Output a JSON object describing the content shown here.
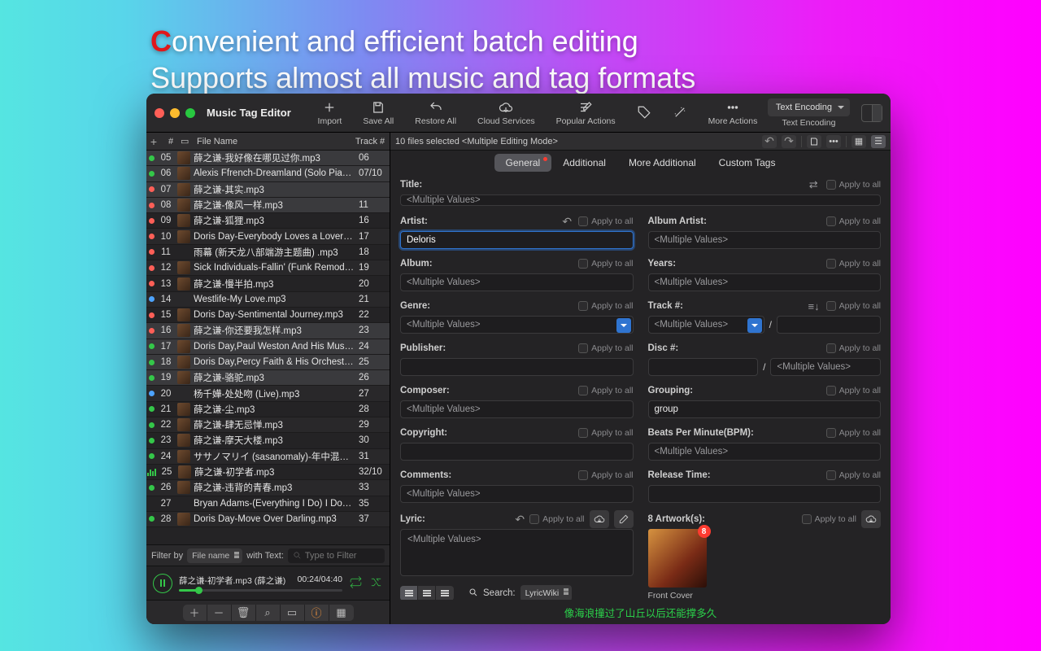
{
  "hero": {
    "cap": "C",
    "line1_rest": "onvenient and efficient batch editing",
    "line2": "Supports almost all music and tag formats"
  },
  "app_title": "Music Tag Editor",
  "toolbar": [
    {
      "icon": "plus",
      "label": "Import"
    },
    {
      "icon": "save",
      "label": "Save All"
    },
    {
      "icon": "undo",
      "label": "Restore All"
    },
    {
      "icon": "cloud",
      "label": "Cloud Services"
    },
    {
      "icon": "edit",
      "label": "Popular Actions"
    },
    {
      "icon": "tag",
      "label": ""
    },
    {
      "icon": "wand",
      "label": ""
    },
    {
      "icon": "dots",
      "label": "More Actions"
    }
  ],
  "text_encoding": {
    "label": "Text Encoding",
    "caption": "Text Encoding"
  },
  "columns": {
    "hash": "#",
    "file": "File Name",
    "track": "Track #"
  },
  "rows": [
    {
      "dot": "g",
      "n": "05",
      "name": "薛之谦-我好像在哪见过你.mp3",
      "trk": "06",
      "sel": true,
      "thumb": true
    },
    {
      "dot": "g",
      "n": "06",
      "name": "Alexis Ffrench-Dreamland (Solo Pia…",
      "trk": "07/10",
      "sel": true,
      "thumb": true
    },
    {
      "dot": "r",
      "n": "07",
      "name": "薛之谦-其实.mp3",
      "trk": "",
      "sel": true,
      "thumb": true
    },
    {
      "dot": "r",
      "n": "08",
      "name": "薛之谦-像风一样.mp3",
      "trk": "11",
      "sel": true,
      "thumb": true
    },
    {
      "dot": "r",
      "n": "09",
      "name": "薛之谦-狐狸.mp3",
      "trk": "16",
      "sel": false,
      "thumb": true
    },
    {
      "dot": "r",
      "n": "10",
      "name": "Doris Day-Everybody Loves a Lover…",
      "trk": "17",
      "sel": false,
      "thumb": true
    },
    {
      "dot": "r",
      "n": "11",
      "name": "雨幕 (新天龙八部端游主题曲) .mp3",
      "trk": "18",
      "sel": false,
      "thumb": false
    },
    {
      "dot": "r",
      "n": "12",
      "name": "Sick Individuals-Fallin' (Funk Remod…",
      "trk": "19",
      "sel": false,
      "thumb": true
    },
    {
      "dot": "r",
      "n": "13",
      "name": "薛之谦-慢半拍.mp3",
      "trk": "20",
      "sel": false,
      "thumb": true
    },
    {
      "dot": "b",
      "n": "14",
      "name": "Westlife-My Love.mp3",
      "trk": "21",
      "sel": false,
      "thumb": false
    },
    {
      "dot": "r",
      "n": "15",
      "name": "Doris Day-Sentimental Journey.mp3",
      "trk": "22",
      "sel": false,
      "thumb": true
    },
    {
      "dot": "r",
      "n": "16",
      "name": "薛之谦-你还要我怎样.mp3",
      "trk": "23",
      "sel": true,
      "thumb": true
    },
    {
      "dot": "g",
      "n": "17",
      "name": "Doris Day,Paul Weston And His Mus…",
      "trk": "24",
      "sel": true,
      "thumb": true
    },
    {
      "dot": "g",
      "n": "18",
      "name": "Doris Day,Percy Faith & His Orchest…",
      "trk": "25",
      "sel": true,
      "thumb": true
    },
    {
      "dot": "g",
      "n": "19",
      "name": "薛之谦-骆驼.mp3",
      "trk": "26",
      "sel": true,
      "thumb": true
    },
    {
      "dot": "b",
      "n": "20",
      "name": "杨千嬅-处处吻 (Live).mp3",
      "trk": "27",
      "sel": false,
      "thumb": false
    },
    {
      "dot": "g",
      "n": "21",
      "name": "薛之谦-尘.mp3",
      "trk": "28",
      "sel": false,
      "thumb": true
    },
    {
      "dot": "g",
      "n": "22",
      "name": "薛之谦-肆无忌惮.mp3",
      "trk": "29",
      "sel": false,
      "thumb": true
    },
    {
      "dot": "g",
      "n": "23",
      "name": "薛之谦-摩天大楼.mp3",
      "trk": "30",
      "sel": false,
      "thumb": true
    },
    {
      "dot": "g",
      "n": "24",
      "name": "ササノマリイ (sasanomaly)-年中混…",
      "trk": "31",
      "sel": false,
      "thumb": true
    },
    {
      "dot": "eq",
      "n": "25",
      "name": "薛之谦-初学者.mp3",
      "trk": "32/10",
      "sel": false,
      "thumb": true
    },
    {
      "dot": "g",
      "n": "26",
      "name": "薛之谦-违背的青春.mp3",
      "trk": "33",
      "sel": false,
      "thumb": true
    },
    {
      "dot": "",
      "n": "27",
      "name": "Bryan Adams-(Everything I Do) I Do…",
      "trk": "35",
      "sel": false,
      "thumb": false
    },
    {
      "dot": "g",
      "n": "28",
      "name": "Doris Day-Move Over Darling.mp3",
      "trk": "37",
      "sel": false,
      "thumb": true
    }
  ],
  "filter": {
    "by": "Filter by",
    "mode": "File name",
    "with": "with Text:",
    "placeholder": "Type to Filter"
  },
  "player": {
    "track": "薛之谦-初学者.mp3 (薛之谦)",
    "time": "00:24/04:40"
  },
  "status": "10 files selected <Multiple Editing Mode>",
  "tabs": [
    "General",
    "Additional",
    "More Additional",
    "Custom Tags"
  ],
  "fields": {
    "title": {
      "label": "Title:",
      "value": "<Multiple Values>",
      "apply": "Apply to all"
    },
    "artist": {
      "label": "Artist:",
      "value": "Deloris",
      "apply": "Apply to all"
    },
    "album_artist": {
      "label": "Album Artist:",
      "value": "<Multiple Values>",
      "apply": "Apply to all"
    },
    "album": {
      "label": "Album:",
      "value": "<Multiple Values>",
      "apply": "Apply to all"
    },
    "years": {
      "label": "Years:",
      "value": "<Multiple Values>",
      "apply": "Apply to all"
    },
    "genre": {
      "label": "Genre:",
      "value": "<Multiple Values>",
      "apply": "Apply to all"
    },
    "trackno": {
      "label": "Track #:",
      "value": "<Multiple Values>",
      "apply": "Apply to all"
    },
    "publisher": {
      "label": "Publisher:",
      "value": "",
      "apply": "Apply to all"
    },
    "discno": {
      "label": "Disc #:",
      "value": "",
      "value2": "<Multiple Values>",
      "apply": "Apply to all"
    },
    "composer": {
      "label": "Composer:",
      "value": "<Multiple Values>",
      "apply": "Apply to all"
    },
    "grouping": {
      "label": "Grouping:",
      "value": "group",
      "apply": "Apply to all"
    },
    "copyright": {
      "label": "Copyright:",
      "value": "",
      "apply": "Apply to all"
    },
    "bpm": {
      "label": "Beats Per Minute(BPM):",
      "value": "<Multiple Values>",
      "apply": "Apply to all"
    },
    "comments": {
      "label": "Comments:",
      "value": "<Multiple Values>",
      "apply": "Apply to all"
    },
    "release": {
      "label": "Release Time:",
      "value": "",
      "apply": "Apply to all"
    },
    "lyric": {
      "label": "Lyric:",
      "value": "<Multiple Values>",
      "apply": "Apply to all"
    },
    "artwork": {
      "label": "8 Artwork(s):",
      "badge": "8",
      "caption": "Front Cover",
      "apply": "Apply to all"
    }
  },
  "search": {
    "label": "Search:",
    "source": "LyricWiki"
  },
  "lyric_line": "像海浪撞过了山丘以后还能撑多久"
}
